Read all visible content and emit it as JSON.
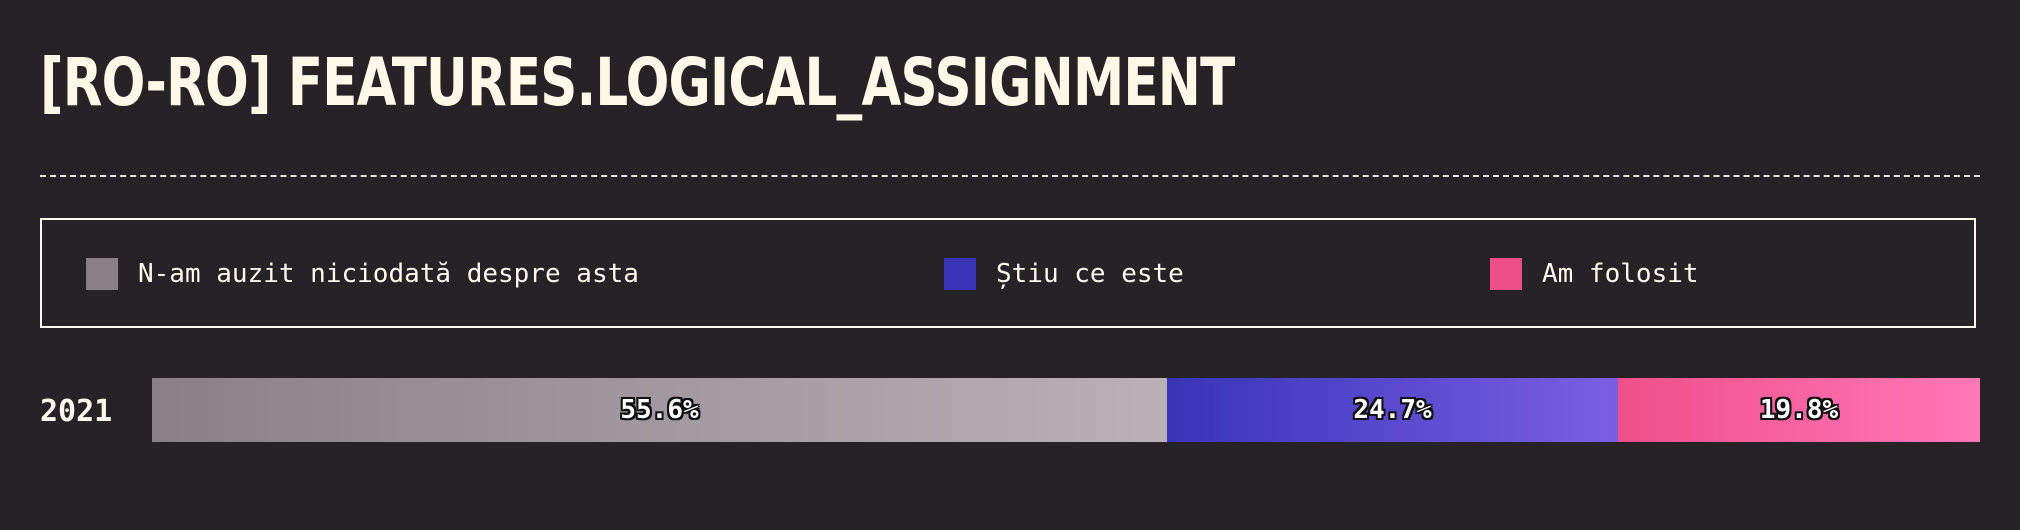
{
  "title": "[RO-RO] FEATURES.LOGICAL_ASSIGNMENT",
  "chart_data": {
    "type": "bar",
    "orientation": "horizontal",
    "stacked": true,
    "percent": true,
    "categories": [
      "2021"
    ],
    "series": [
      {
        "name": "N-am auzit niciodată despre asta",
        "values": [
          55.6
        ],
        "label": "55.6%",
        "color": "#8a8088"
      },
      {
        "name": "Știu ce este",
        "values": [
          24.7
        ],
        "label": "24.7%",
        "color": "#3a34b8"
      },
      {
        "name": "Am folosit",
        "values": [
          19.8
        ],
        "label": "19.8%",
        "color": "#ef4f89"
      }
    ],
    "legend_position": "top",
    "grid": false
  }
}
